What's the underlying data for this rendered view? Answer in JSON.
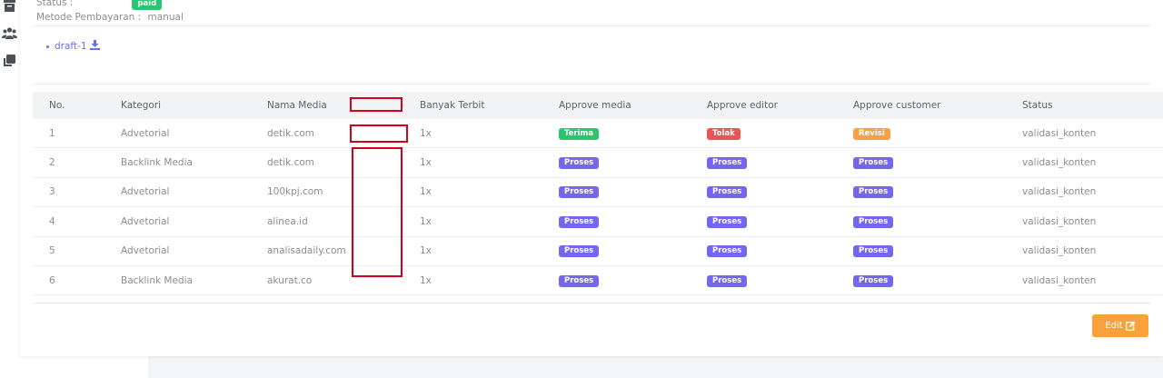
{
  "sidebar": {
    "icons": [
      "archive-icon",
      "users-icon",
      "clone-icon"
    ]
  },
  "info": {
    "status_label": "Status :",
    "status_value": "paid",
    "payment_label": "Metode Pembayaran :",
    "payment_value": "manual"
  },
  "draft": {
    "link_text": "draft-1",
    "icon": "download-icon"
  },
  "table": {
    "headers": [
      "No.",
      "Kategori",
      "Nama Media",
      "",
      "Banyak Terbit",
      "Approve media",
      "Approve editor",
      "Approve customer",
      "Status"
    ],
    "rows": [
      {
        "no": "1",
        "kategori": "Advetorial",
        "media": "detik.com",
        "terbit": "1x",
        "approve_media": "Terima",
        "approve_editor": "Tolak",
        "approve_customer": "Revisi",
        "status": "validasi_konten"
      },
      {
        "no": "2",
        "kategori": "Backlink Media",
        "media": "detik.com",
        "terbit": "1x",
        "approve_media": "Proses",
        "approve_editor": "Proses",
        "approve_customer": "Proses",
        "status": "validasi_konten"
      },
      {
        "no": "3",
        "kategori": "Advetorial",
        "media": "100kpj.com",
        "terbit": "1x",
        "approve_media": "Proses",
        "approve_editor": "Proses",
        "approve_customer": "Proses",
        "status": "validasi_konten"
      },
      {
        "no": "4",
        "kategori": "Advetorial",
        "media": "alinea.id",
        "terbit": "1x",
        "approve_media": "Proses",
        "approve_editor": "Proses",
        "approve_customer": "Proses",
        "status": "validasi_konten"
      },
      {
        "no": "5",
        "kategori": "Advetorial",
        "media": "analisadaily.com",
        "terbit": "1x",
        "approve_media": "Proses",
        "approve_editor": "Proses",
        "approve_customer": "Proses",
        "status": "validasi_konten"
      },
      {
        "no": "6",
        "kategori": "Backlink Media",
        "media": "akurat.co",
        "terbit": "1x",
        "approve_media": "Proses",
        "approve_editor": "Proses",
        "approve_customer": "Proses",
        "status": "validasi_konten"
      }
    ]
  },
  "badge_colors": {
    "paid": "#28c76f",
    "Terima": "#28c76f",
    "Tolak": "#ea5455",
    "Revisi": "#ff9f43",
    "Proses": "#7367f0"
  },
  "edit_button": {
    "label": "Edit",
    "icon": "edit-icon",
    "color": "#f9a23d"
  }
}
